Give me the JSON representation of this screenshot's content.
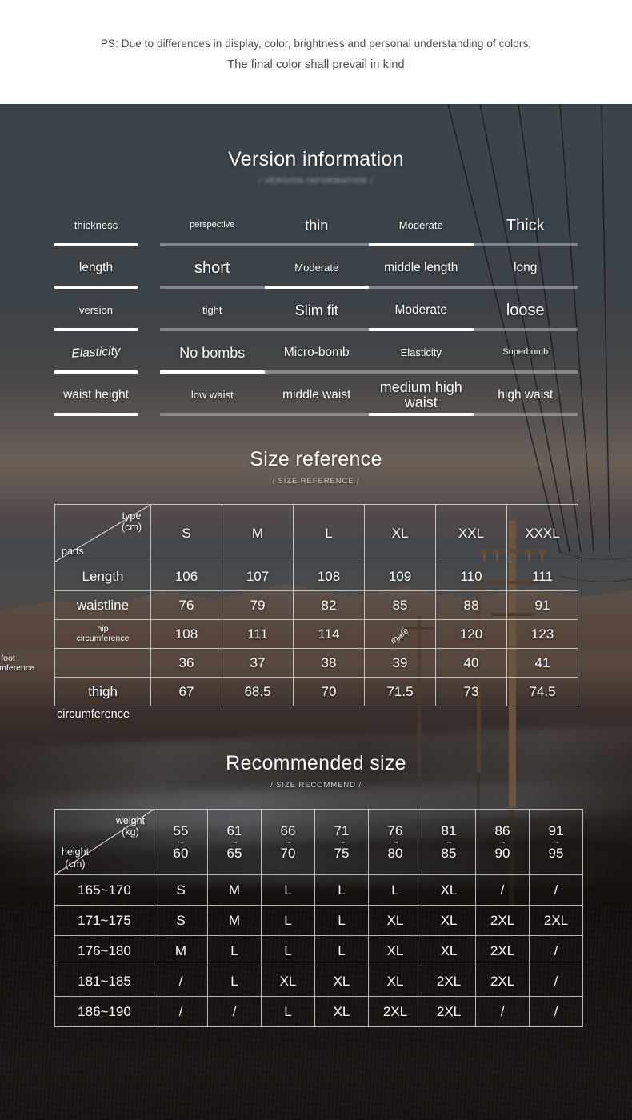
{
  "disclaimer": {
    "line1": "PS: Due to differences in display, color, brightness and personal understanding of colors,",
    "line2": "The final color shall prevail in kind"
  },
  "version_information": {
    "title": "Version information",
    "subtitle": "/ VERSION INFORMATION /",
    "rows": [
      {
        "label": "thickness",
        "label_size": "t-sm",
        "options": [
          {
            "text": "perspective",
            "size": "t-xs"
          },
          {
            "text": "thin",
            "size": "t-lg"
          },
          {
            "text": "Moderate",
            "size": "t-sm"
          },
          {
            "text": "Thick",
            "size": "t-xl"
          }
        ],
        "selected_index": 2
      },
      {
        "label": "length",
        "label_size": "t-md",
        "options": [
          {
            "text": "short",
            "size": "t-xl"
          },
          {
            "text": "Moderate",
            "size": "t-sm"
          },
          {
            "text": "middle length",
            "size": "t-md"
          },
          {
            "text": "long",
            "size": "t-md"
          }
        ],
        "selected_index": 1
      },
      {
        "label": "version",
        "label_size": "t-sm",
        "options": [
          {
            "text": "tight",
            "size": "t-sm"
          },
          {
            "text": "Slim fit",
            "size": "t-lg"
          },
          {
            "text": "Moderate",
            "size": "t-md"
          },
          {
            "text": "loose",
            "size": "t-xl"
          }
        ],
        "selected_index": 2
      },
      {
        "label": "Elasticity",
        "label_size": "t-md",
        "label_style": "italic-skew",
        "options": [
          {
            "text": "No bombs",
            "size": "t-lg"
          },
          {
            "text": "Micro-bomb",
            "size": "t-md"
          },
          {
            "text": "Elasticity",
            "size": "t-sm"
          },
          {
            "text": "Superbomb",
            "size": "t-xs"
          }
        ],
        "selected_index": 0
      },
      {
        "label": "waist height",
        "label_size": "t-md",
        "options": [
          {
            "text": "low waist",
            "size": "t-sm"
          },
          {
            "text": "middle waist",
            "size": "t-md"
          },
          {
            "text": "medium high waist",
            "size": "t-lg"
          },
          {
            "text": "high waist",
            "size": "t-md"
          }
        ],
        "selected_index": 2
      }
    ]
  },
  "size_reference": {
    "title": "Size reference",
    "subtitle": "/ SIZE REFERENCE /",
    "corner": {
      "top_right": "type (cm)",
      "bottom_left": "parts"
    },
    "columns": [
      "S",
      "M",
      "L",
      "XL",
      "XXL",
      "XXXL"
    ],
    "rows": [
      {
        "label": "Length",
        "label_small": false,
        "values": [
          "106",
          "107",
          "108",
          "109",
          "110",
          "111"
        ]
      },
      {
        "label": "waistline",
        "label_small": false,
        "values": [
          "76",
          "79",
          "82",
          "85",
          "88",
          "91"
        ]
      },
      {
        "label": "hip circumference",
        "label_small": true,
        "values": [
          "108",
          "111",
          "114",
          "male",
          "120",
          "123"
        ]
      },
      {
        "label": "foot circumference",
        "label_small": true,
        "spill": "left",
        "values": [
          "36",
          "37",
          "38",
          "39",
          "40",
          "41"
        ]
      },
      {
        "label": "thigh",
        "label_small": false,
        "spill": "below",
        "spill_text": "circumference",
        "values": [
          "67",
          "68.5",
          "70",
          "71.5",
          "73",
          "74.5"
        ]
      }
    ],
    "watermark": "male"
  },
  "recommended_size": {
    "title": "Recommended size",
    "subtitle": "/ SIZE RECOMMEND /",
    "corner": {
      "top_right": "weight (kg)",
      "bottom_left": "height (cm)"
    },
    "weight_columns": [
      {
        "from": "55",
        "to": "60"
      },
      {
        "from": "61",
        "to": "65"
      },
      {
        "from": "66",
        "to": "70"
      },
      {
        "from": "71",
        "to": "75"
      },
      {
        "from": "76",
        "to": "80"
      },
      {
        "from": "81",
        "to": "85"
      },
      {
        "from": "86",
        "to": "90"
      },
      {
        "from": "91",
        "to": "95"
      }
    ],
    "rows": [
      {
        "height": "165~170",
        "values": [
          "S",
          "M",
          "L",
          "L",
          "L",
          "XL",
          "/",
          "/"
        ]
      },
      {
        "height": "171~175",
        "values": [
          "S",
          "M",
          "L",
          "L",
          "XL",
          "XL",
          "2XL",
          "2XL"
        ]
      },
      {
        "height": "176~180",
        "values": [
          "M",
          "L",
          "L",
          "L",
          "XL",
          "XL",
          "2XL",
          "/"
        ]
      },
      {
        "height": "181~185",
        "values": [
          "/",
          "L",
          "XL",
          "XL",
          "XL",
          "2XL",
          "2XL",
          "/"
        ]
      },
      {
        "height": "186~190",
        "values": [
          "/",
          "/",
          "L",
          "XL",
          "2XL",
          "2XL",
          "/",
          "/"
        ]
      }
    ]
  },
  "colors": {
    "page_bg": "#ffffff",
    "photo_slate": "#3a4349",
    "photo_dark": "#151110",
    "text_on_photo": "#ffffff",
    "track": "#b9bec0",
    "track_fill": "#ffffff",
    "grid_line": "#e2e4e4"
  }
}
